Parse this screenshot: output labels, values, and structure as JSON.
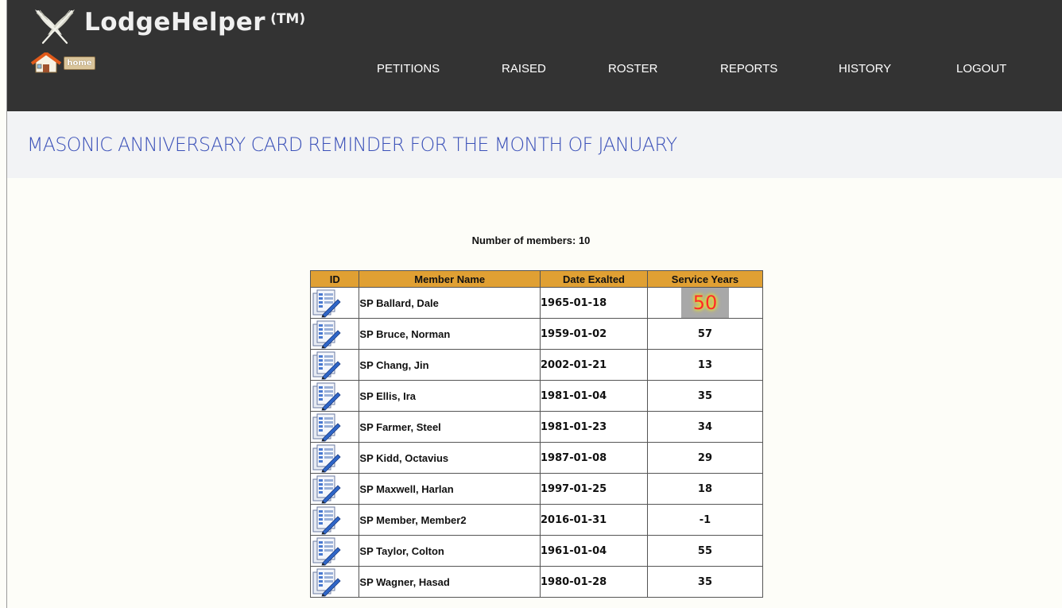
{
  "brand": {
    "name": "LodgeHelper",
    "tm": "(TM)"
  },
  "home_button": {
    "label": "home"
  },
  "nav": [
    {
      "label": "PETITIONS"
    },
    {
      "label": "RAISED"
    },
    {
      "label": "ROSTER"
    },
    {
      "label": "REPORTS"
    },
    {
      "label": "HISTORY"
    },
    {
      "label": "LOGOUT"
    }
  ],
  "page_title": "MASONIC ANNIVERSARY CARD REMINDER FOR THE MONTH OF JANUARY",
  "member_count_text": "Number of members: 10",
  "table": {
    "headers": [
      "ID",
      "Member Name",
      "Date Exalted",
      "Service Years"
    ],
    "rows": [
      {
        "name": "SP Ballard, Dale",
        "date": "1965-01-18",
        "years": "50",
        "highlight": true
      },
      {
        "name": "SP Bruce, Norman",
        "date": "1959-01-02",
        "years": "57"
      },
      {
        "name": "SP Chang, Jin",
        "date": "2002-01-21",
        "years": "13"
      },
      {
        "name": "SP Ellis, Ira",
        "date": "1981-01-04",
        "years": "35"
      },
      {
        "name": "SP Farmer, Steel",
        "date": "1981-01-23",
        "years": "34"
      },
      {
        "name": "SP Kidd, Octavius",
        "date": "1987-01-08",
        "years": "29"
      },
      {
        "name": "SP Maxwell, Harlan",
        "date": "1997-01-25",
        "years": "18"
      },
      {
        "name": "SP Member, Member2",
        "date": "2016-01-31",
        "years": "-1"
      },
      {
        "name": "SP Taylor, Colton",
        "date": "1961-01-04",
        "years": "55"
      },
      {
        "name": "SP Wagner, Hasad",
        "date": "1980-01-28",
        "years": "35"
      }
    ]
  },
  "icons": {
    "logo": "crossed-quills-icon",
    "home": "house-icon",
    "edit": "edit-document-icon"
  },
  "colors": {
    "header_bg": "#333333",
    "title_band_bg": "#f2f3f5",
    "title_text": "#3a50b8",
    "table_header_bg": "#e0a033",
    "page_bg": "#fdfdf8",
    "highlight_bg": "#a8a8a8",
    "highlight_text": "#ff2a2a"
  }
}
